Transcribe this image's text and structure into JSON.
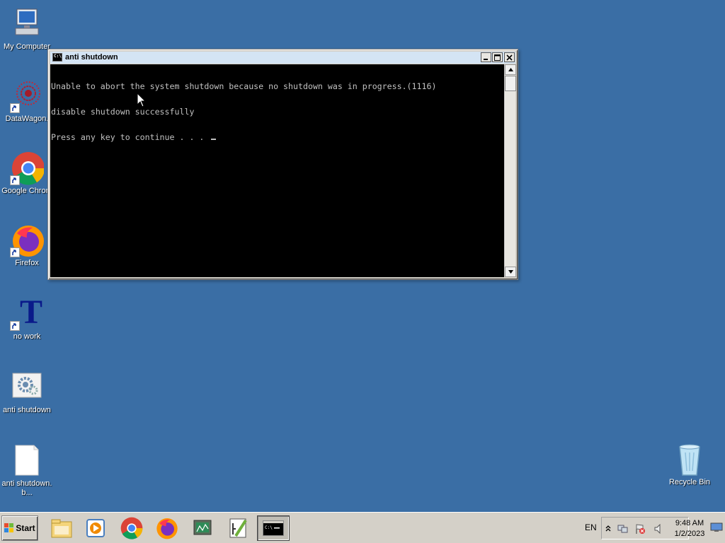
{
  "desktop": {
    "icons": [
      {
        "label": "My Computer"
      },
      {
        "label": "DataWagon."
      },
      {
        "label": "Google Chrom"
      },
      {
        "label": "Firefox"
      },
      {
        "label": "no work"
      },
      {
        "label": "anti shutdown"
      },
      {
        "label": "anti shutdown.b..."
      },
      {
        "label": "Recycle Bin"
      }
    ],
    "no_work_glyph": "T"
  },
  "window": {
    "title": "anti shutdown",
    "console_lines": [
      "Unable to abort the system shutdown because no shutdown was in progress.(1116)",
      "disable shutdown successfully",
      "Press any key to continue . . . "
    ]
  },
  "taskbar": {
    "start_label": "Start",
    "language": "EN",
    "clock_time": "9:48 AM",
    "clock_date": "1/2/2023"
  },
  "colors": {
    "desktop": "#3a6ea5",
    "console_bg": "#000000",
    "console_text": "#c0c0c0",
    "taskbar": "#d4d0c8"
  }
}
